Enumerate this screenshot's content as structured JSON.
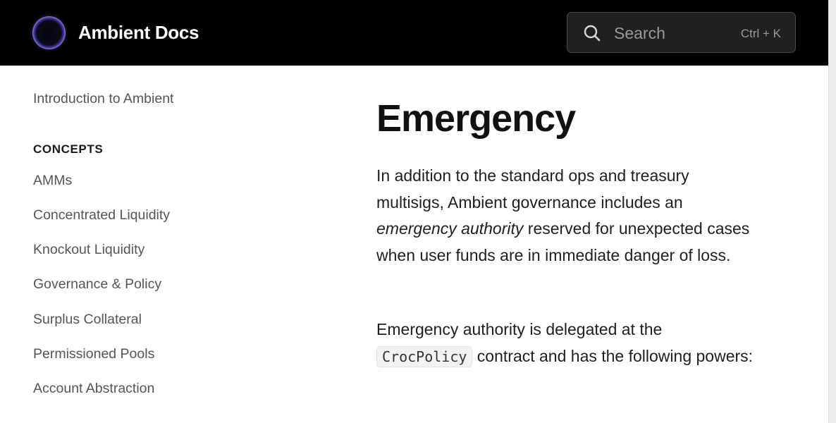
{
  "header": {
    "brand": "Ambient Docs",
    "search": {
      "placeholder": "Search",
      "shortcut": "Ctrl + K"
    }
  },
  "sidebar": {
    "intro_link": "Introduction to Ambient",
    "concepts_heading": "CONCEPTS",
    "items": [
      {
        "label": "AMMs"
      },
      {
        "label": "Concentrated Liquidity"
      },
      {
        "label": "Knockout Liquidity"
      },
      {
        "label": "Governance & Policy"
      },
      {
        "label": "Surplus Collateral"
      },
      {
        "label": "Permissioned Pools"
      },
      {
        "label": "Account Abstraction"
      }
    ]
  },
  "main": {
    "title": "Emergency",
    "para1": {
      "text_a": "In addition to the standard ops and treasury multisigs, Ambient governance includes an ",
      "emphasis": "emergency authority",
      "text_b": " reserved for unexpected cases when user funds are in immediate danger of loss."
    },
    "para2": {
      "text_a": "Emergency authority is delegated at the ",
      "code": "CrocPolicy",
      "text_b": " contract and has the following powers:"
    }
  },
  "colors": {
    "header_bg": "#000000",
    "accent": "#8f84ef",
    "text": "#1f1f1f",
    "sidebar_text": "#555555"
  }
}
